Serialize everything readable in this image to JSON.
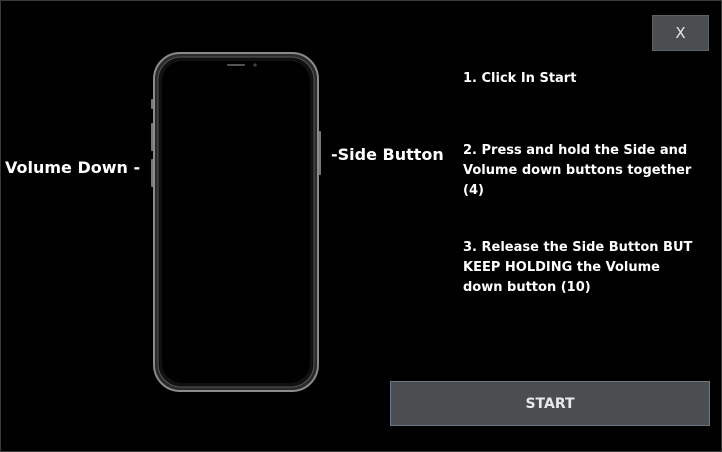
{
  "window": {
    "close_label": "X"
  },
  "phone": {
    "icon": "iphone-outline-icon",
    "left_label": "Volume Down -",
    "right_label": "-Side Button"
  },
  "steps": [
    "1. Click In Start",
    "2. Press and hold the Side and Volume down buttons together (4)",
    "3. Release the Side Button BUT KEEP HOLDING the Volume down button (10)"
  ],
  "start_button": {
    "label": "START"
  },
  "colors": {
    "background": "#000000",
    "button_bg": "#4b4e51",
    "text": "#ffffff"
  }
}
